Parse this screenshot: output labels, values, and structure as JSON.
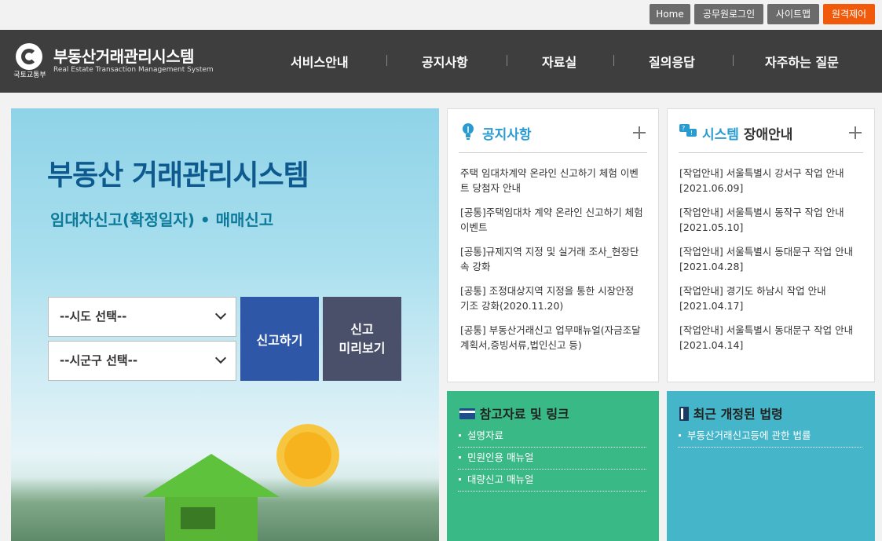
{
  "topbar": {
    "home": "Home",
    "official_login": "공무원로그인",
    "sitemap": "사이트맵",
    "remote_control": "원격제어"
  },
  "header": {
    "ministry": "국토교통부",
    "title": "부동산거래관리시스템",
    "subtitle": "Real Estate Transaction Management System",
    "nav": [
      "서비스안내",
      "공지사항",
      "자료실",
      "질의응답",
      "자주하는 질문"
    ]
  },
  "hero": {
    "title": "부동산 거래관리시스템",
    "subtitle": "임대차신고(확정일자) • 매매신고",
    "sido_select": "--시도 선택--",
    "sigungu_select": "--시군구 선택--",
    "report_button": "신고하기",
    "preview_button_line1": "신고",
    "preview_button_line2": "미리보기"
  },
  "notice": {
    "title": "공지사항",
    "items": [
      "주택 임대차계약 온라인 신고하기 체험 이벤트 당첨자 안내",
      "[공통]주택임대차 계약 온라인 신고하기 체험 이벤트",
      "[공통]규제지역 지정 및 실거래 조사_현장단속 강화",
      "[공통] 조정대상지역 지정을 통한 시장안정 기조 강화(2020.11.20)",
      "[공통] 부동산거래신고 업무매뉴얼(자금조달계획서,증빙서류,법인신고 등)"
    ]
  },
  "system": {
    "title_accent": "시스템",
    "title_rest": "장애안내",
    "items": [
      "[작업안내] 서울특별시 강서구 작업 안내 [2021.06.09]",
      "[작업안내] 서울특별시 동작구 작업 안내 [2021.05.10]",
      "[작업안내] 서울특별시 동대문구 작업 안내 [2021.04.28]",
      "[작업안내] 경기도 하남시 작업 안내 [2021.04.17]",
      "[작업안내] 서울특별시 동대문구 작업 안내 [2021.04.14]"
    ]
  },
  "reference": {
    "title": "참고자료 및 링크",
    "items": [
      "설명자료",
      "민원인용 매뉴얼",
      "대량신고 매뉴얼"
    ]
  },
  "law": {
    "title": "최근 개정된 법령",
    "items": [
      "부동산거래신고등에 관한 법률"
    ]
  },
  "colors": {
    "header_bg": "#3e3e3e",
    "accent_orange": "#f05a0a",
    "report_blue": "#2f57a8",
    "preview_slate": "#4a4f6a",
    "reference_green": "#39b985",
    "law_teal": "#45b6c9",
    "title_blue": "#2a9bd1"
  }
}
